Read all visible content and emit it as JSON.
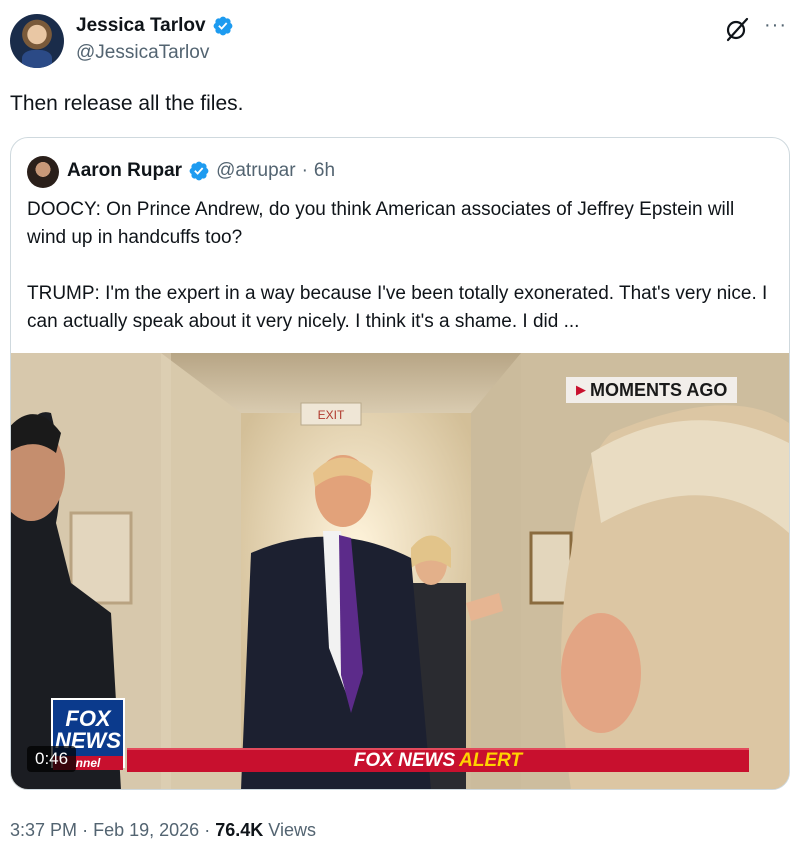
{
  "tweet": {
    "author_name": "Jessica Tarlov",
    "author_handle": "@JessicaTarlov",
    "text": "Then release all the files.",
    "time": "3:37 PM",
    "date": "Feb 19, 2026",
    "views_count": "76.4K",
    "views_label": "Views",
    "separator": "·"
  },
  "quote": {
    "author_name": "Aaron Rupar",
    "author_handle": "@atrupar",
    "age": "6h",
    "separator": "·",
    "text": "DOOCY: On Prince Andrew, do you think American associates of Jeffrey Epstein will wind up in handcuffs too?\n\nTRUMP: I'm the expert in a way because I've been totally exonerated. That's very nice. I can actually speak about it very nicely. I think it's a shame. I did ..."
  },
  "video": {
    "duration": "0:46",
    "badge": "MOMENTS AGO",
    "exit_sign": "EXIT",
    "logo_line1": "FOX",
    "logo_line2": "NEWS",
    "logo_line3": "nnel",
    "alert_brand": "FOX NEWS",
    "alert_word": "ALERT"
  },
  "icons": {
    "verified": "verified-badge-icon",
    "grok": "grok-icon",
    "more": "more-icon"
  },
  "colors": {
    "verified_blue": "#1d9bf0",
    "secondary_text": "#536471",
    "fox_red": "#c8102e",
    "fox_blue": "#0b3a8c",
    "alert_yellow": "#ffd200"
  }
}
